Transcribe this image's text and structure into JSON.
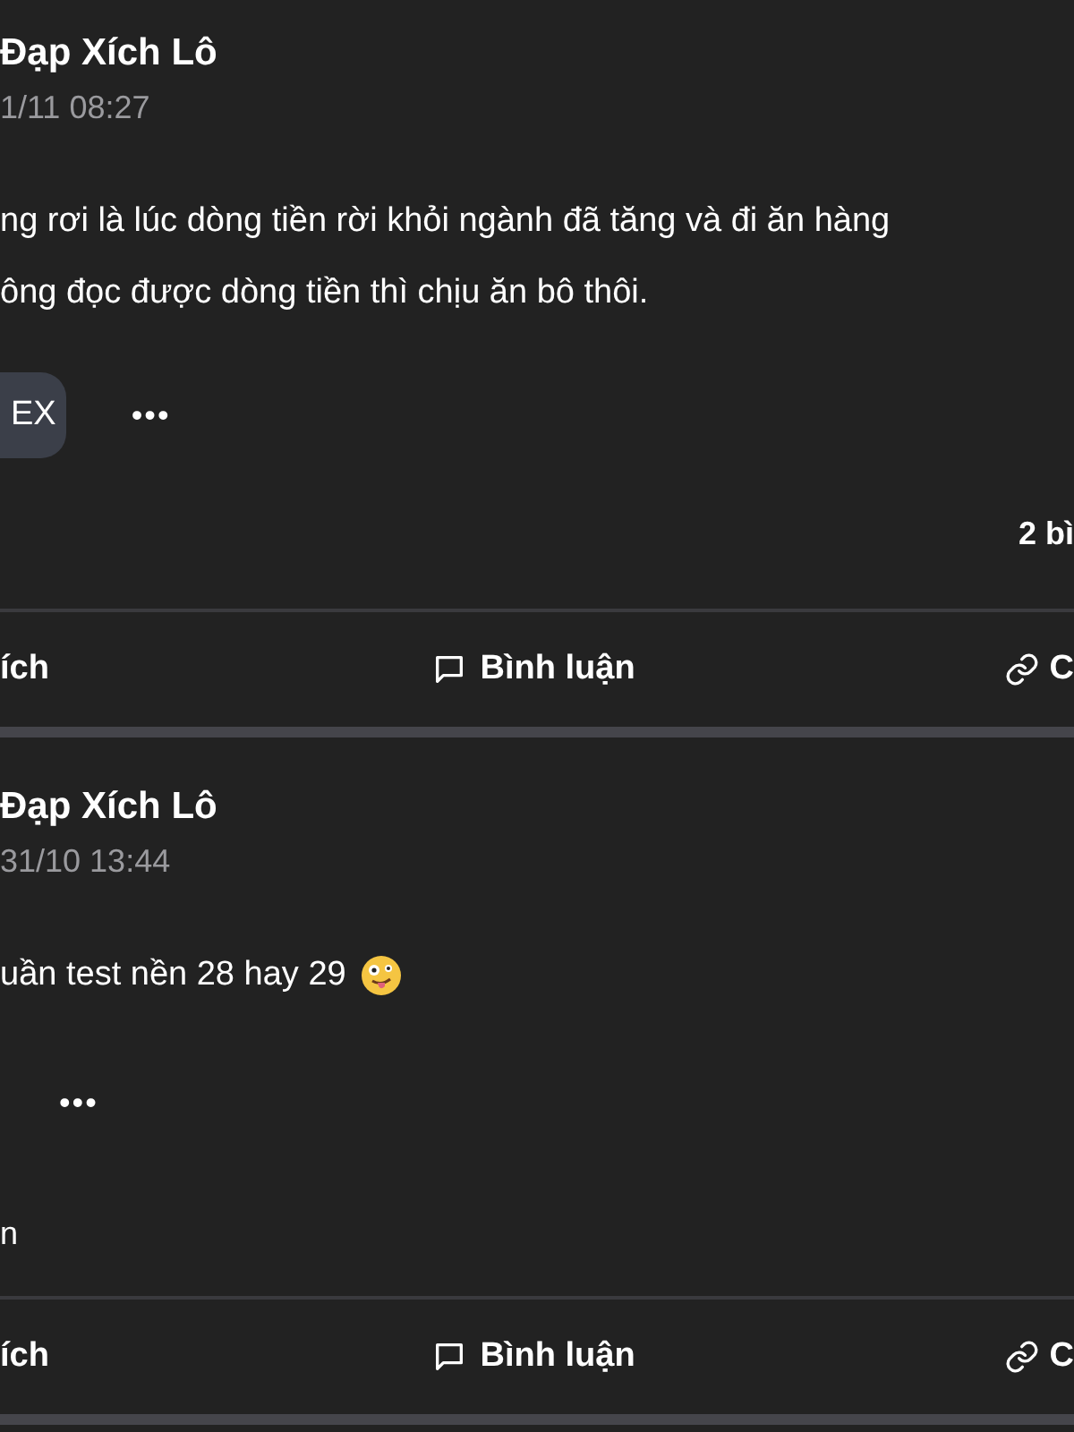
{
  "posts": [
    {
      "author": "Đạp Xích Lô",
      "time": "1/11 08:27",
      "lines": [
        {
          "kind": "plain",
          "text": "ng rơi là lúc dòng tiền rời khỏi ngành đã tăng và đi ăn hàng"
        },
        {
          "kind": "plain",
          "text": "ông đọc được dòng tiền thì chịu ăn bô thôi."
        }
      ],
      "tags": [
        "EX"
      ],
      "more": "•••",
      "stats": {
        "kind": "comments",
        "text": "2 bì"
      },
      "actions": [
        {
          "kind": "like",
          "label": "ích"
        },
        {
          "kind": "comment",
          "label": "Bình luận"
        },
        {
          "kind": "share",
          "label": "C"
        }
      ]
    },
    {
      "author": "Đạp Xích Lô",
      "time": "31/10 13:44",
      "lines": [
        {
          "kind": "with_emoji",
          "text": "uần test nền 28 hay 29"
        }
      ],
      "more": "•••",
      "stats": {
        "kind": "reactions",
        "text": "n"
      },
      "actions": [
        {
          "kind": "like",
          "label": "ích"
        },
        {
          "kind": "comment",
          "label": "Bình luận"
        },
        {
          "kind": "share",
          "label": "C"
        }
      ]
    }
  ]
}
